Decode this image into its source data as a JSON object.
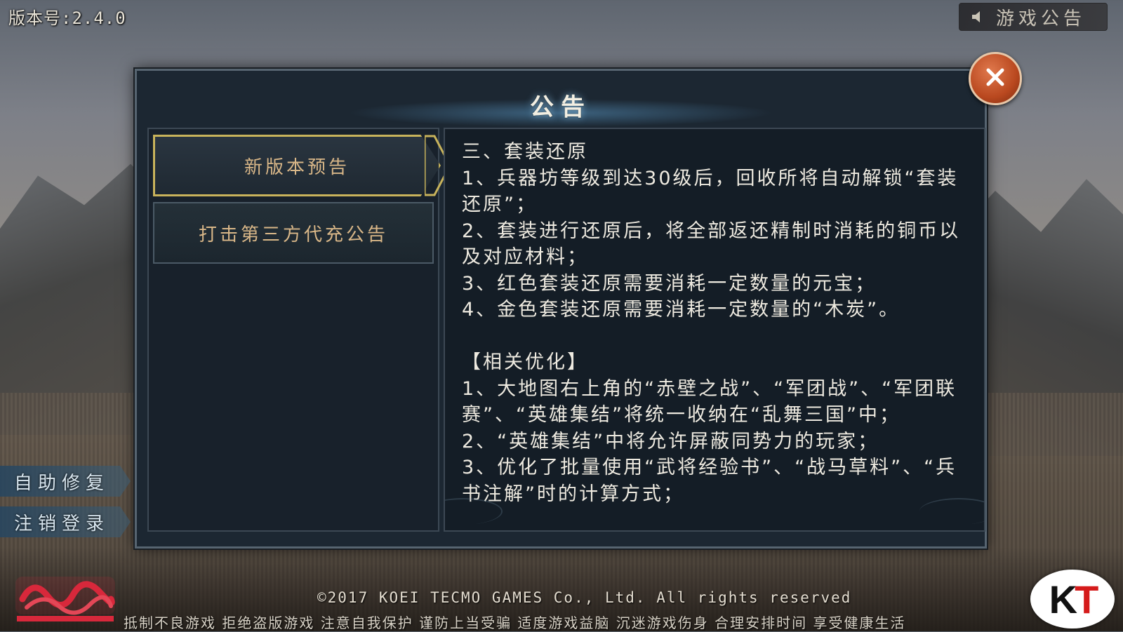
{
  "version_label": "版本号:2.4.0",
  "announce_button": {
    "label": "游戏公告",
    "icon": "speaker-icon"
  },
  "dialog": {
    "title": "公告",
    "close_icon": "close-icon",
    "tabs": [
      {
        "label": "新版本预告",
        "active": true
      },
      {
        "label": "打击第三方代充公告",
        "active": false
      }
    ],
    "content": "三、套装还原\n1、兵器坊等级到达30级后，回收所将自动解锁“套装还原”；\n2、套装进行还原后，将全部返还精制时消耗的铜币以及对应材料；\n3、红色套装还原需要消耗一定数量的元宝；\n4、金色套装还原需要消耗一定数量的“木炭”。\n\n【相关优化】\n1、大地图右上角的“赤壁之战”、“军团战”、“军团联赛”、“英雄集结”将统一收纳在“乱舞三国”中；\n2、“英雄集结”中将允许屏蔽同势力的玩家；\n3、优化了批量使用“武将经验书”、“战马草料”、“兵书注解”时的计算方式；"
  },
  "side_buttons": {
    "repair": "自助修复",
    "logout": "注销登录"
  },
  "footer": {
    "copyright": "©2017  KOEI TECMO GAMES Co., Ltd. All rights reserved",
    "health_notice": "抵制不良游戏 拒绝盗版游戏 注意自我保护 谨防上当受骗 适度游戏益脑 沉迷游戏伤身 合理安排时间 享受健康生活",
    "publisher_logo": "KT"
  },
  "colors": {
    "accent_gold": "#c8b35b",
    "tab_text": "#d9b788",
    "close_button": "#c4521f",
    "panel_bg": "#141d26"
  }
}
